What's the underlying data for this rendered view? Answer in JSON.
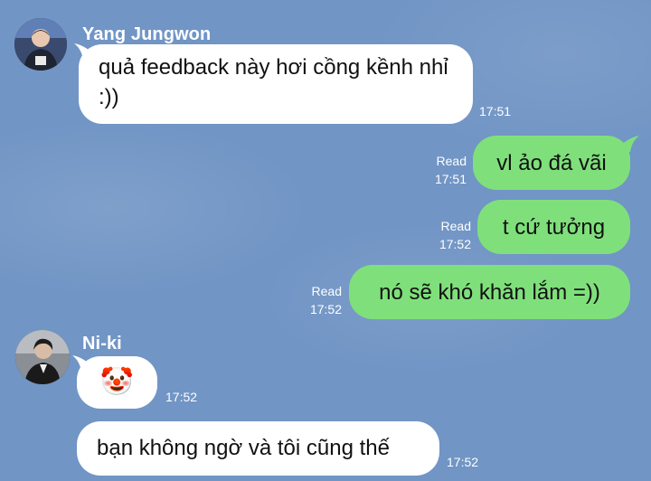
{
  "messages": {
    "m1": {
      "sender": "Yang Jungwon",
      "text": "quả feedback này hơi cồng kềnh nhỉ :))",
      "time": "17:51"
    },
    "m2": {
      "text": "vl ảo đá vãi",
      "status": "Read",
      "time": "17:51"
    },
    "m3": {
      "text": "t cứ tưởng",
      "status": "Read",
      "time": "17:52"
    },
    "m4": {
      "text": "nó sẽ khó khăn lắm =))",
      "status": "Read",
      "time": "17:52"
    },
    "m5": {
      "sender": "Ni-ki",
      "emoji": "🤡",
      "time": "17:52"
    },
    "m6": {
      "text": "bạn không ngờ và tôi cũng thế",
      "time": "17:52"
    }
  },
  "icons": {
    "m5_emoji": "clown-face-emoji"
  },
  "colors": {
    "background": "#7195c5",
    "incoming_bubble": "#ffffff",
    "outgoing_bubble": "#7fe07b",
    "text": "#111111",
    "meta_text": "#ffffff"
  }
}
